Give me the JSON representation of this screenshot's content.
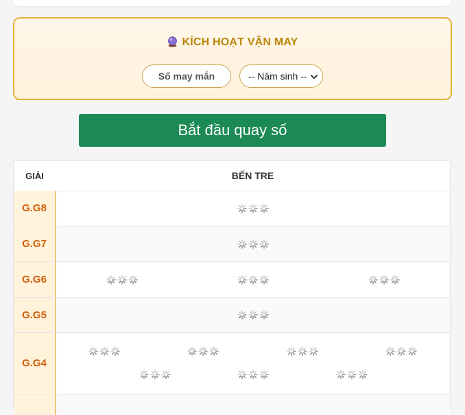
{
  "luck_panel": {
    "title": "KÍCH HOẠT VẬN MAY",
    "title_icon": "crystal-ball-icon",
    "lucky_number_label": "Số may mắn",
    "birth_year_select": {
      "selected": "-- Năm sinh --",
      "options": [
        "-- Năm sinh --"
      ]
    }
  },
  "spin_button": {
    "label": "Bắt đầu quay số"
  },
  "results_table": {
    "headers": {
      "prize": "GIẢI",
      "province": "BẾN TRE"
    },
    "rows": [
      {
        "prize": "G.G8",
        "count": 1
      },
      {
        "prize": "G.G7",
        "count": 1
      },
      {
        "prize": "G.G6",
        "count": 3
      },
      {
        "prize": "G.G5",
        "count": 1
      },
      {
        "prize": "G.G4",
        "count": 7
      }
    ],
    "loading_icon": "loading-spinner-icon"
  },
  "colors": {
    "accent_gold": "#e3b23c",
    "title_gold": "#b8860b",
    "spin_green": "#1c8a55",
    "prize_label_orange": "#d35f0a",
    "prize_label_bg": "#fff3dc"
  }
}
